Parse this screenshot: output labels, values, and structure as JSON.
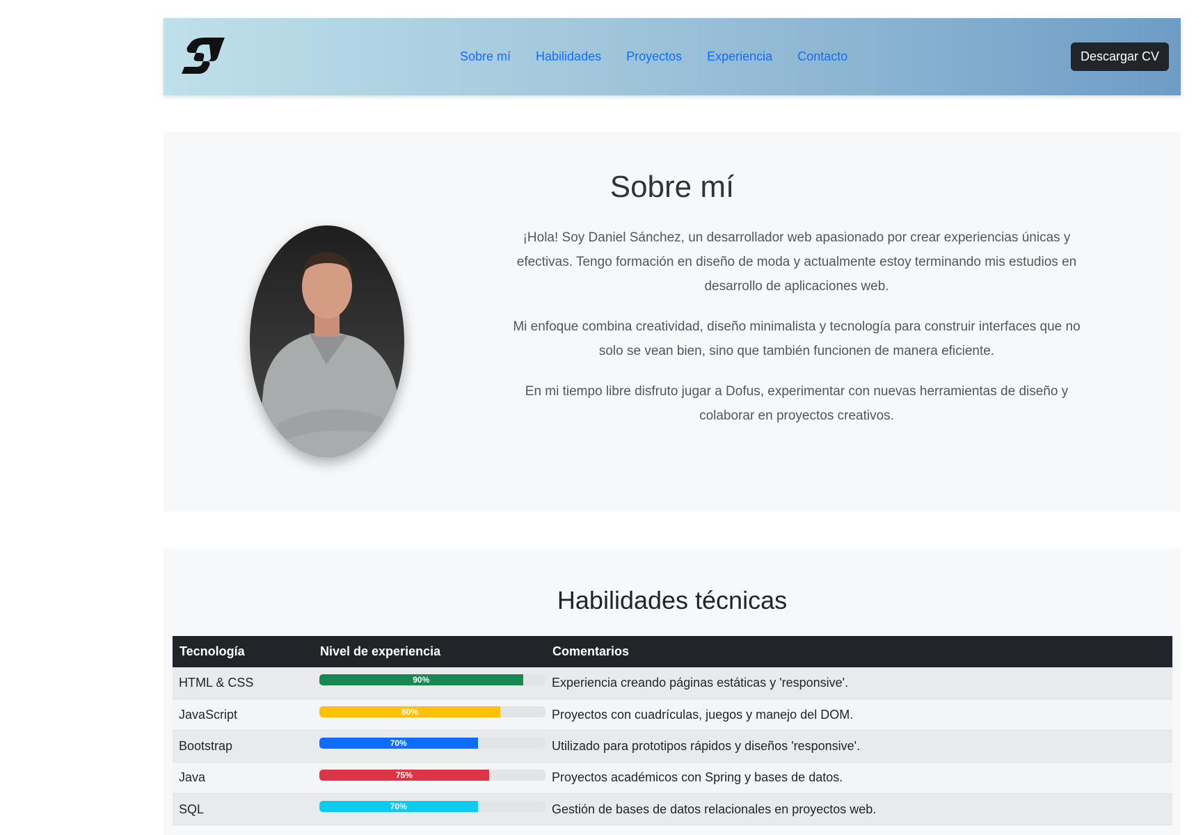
{
  "navbar": {
    "logo_name": "logo",
    "links": [
      "Sobre mí",
      "Habilidades",
      "Proyectos",
      "Experiencia",
      "Contacto"
    ],
    "cv_button": "Descargar CV"
  },
  "about": {
    "title": "Sobre mí",
    "paragraphs": [
      "¡Hola! Soy Daniel Sánchez, un desarrollador web apasionado por crear experiencias únicas y efectivas. Tengo formación en diseño de moda y actualmente estoy terminando mis estudios en desarrollo de aplicaciones web.",
      "Mi enfoque combina creatividad, diseño minimalista y tecnología para construir interfaces que no solo se vean bien, sino que también funcionen de manera eficiente.",
      "En mi tiempo libre disfruto jugar a Dofus, experimentar con nuevas herramientas de diseño y colaborar en proyectos creativos."
    ]
  },
  "skills": {
    "title": "Habilidades técnicas",
    "headers": [
      "Tecnología",
      "Nivel de experiencia",
      "Comentarios"
    ],
    "rows": [
      {
        "tech": "HTML & CSS",
        "level": 90,
        "label": "90%",
        "color": "#198754",
        "comment": "Experiencia creando páginas estáticas y 'responsive'."
      },
      {
        "tech": "JavaScript",
        "level": 80,
        "label": "80%",
        "color": "#ffc107",
        "comment": "Proyectos con cuadrículas, juegos y manejo del DOM."
      },
      {
        "tech": "Bootstrap",
        "level": 70,
        "label": "70%",
        "color": "#0d6efd",
        "comment": "Utilizado para prototipos rápidos y diseños 'responsive'."
      },
      {
        "tech": "Java",
        "level": 75,
        "label": "75%",
        "color": "#dc3545",
        "comment": "Proyectos académicos con Spring y bases de datos."
      },
      {
        "tech": "SQL",
        "level": 70,
        "label": "70%",
        "color": "#0dcaf0",
        "comment": "Gestión de bases de datos relacionales en proyectos web."
      }
    ]
  }
}
